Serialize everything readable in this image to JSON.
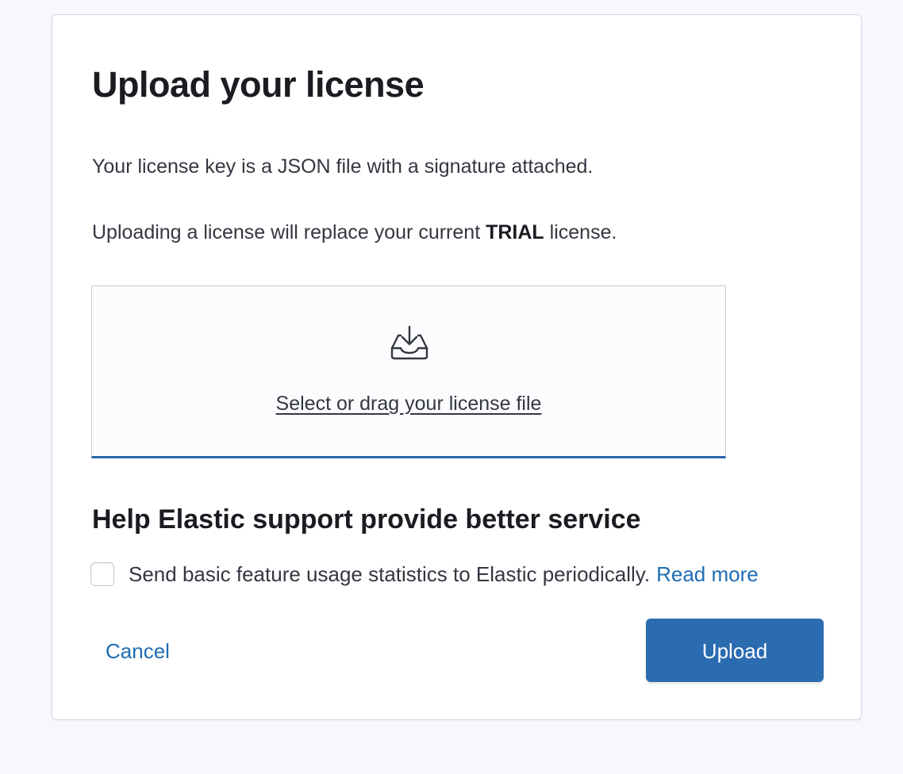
{
  "panel": {
    "title": "Upload your license",
    "description_1": "Your license key is a JSON file with a signature attached.",
    "description_2_before": "Uploading a license will replace your current ",
    "description_2_strong": "TRIAL",
    "description_2_after": " license."
  },
  "dropzone": {
    "icon": "upload-tray-icon",
    "label": "Select or drag your license file"
  },
  "telemetry": {
    "title": "Help Elastic support provide better service",
    "checkbox_label": "Send basic feature usage statistics to Elastic periodically.",
    "checked": false,
    "read_more": "Read more"
  },
  "actions": {
    "cancel": "Cancel",
    "upload": "Upload"
  },
  "colors": {
    "accent": "#2b6cb0",
    "link": "#1e6cb5",
    "background": "#f7f8fc"
  }
}
